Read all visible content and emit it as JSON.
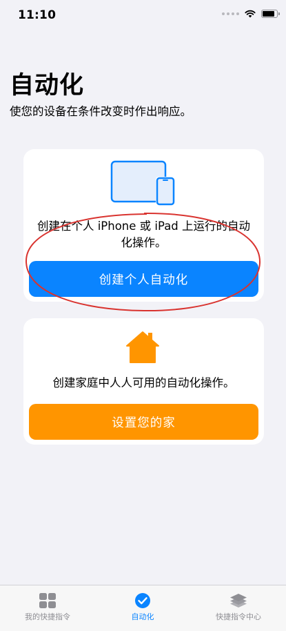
{
  "status_bar": {
    "time": "11:10"
  },
  "header": {
    "title": "自动化",
    "subtitle": "使您的设备在条件改变时作出响应。"
  },
  "personal_card": {
    "icon": "iphone-ipad-icon",
    "description_line1": "创建在个人 iPhone 或 iPad 上运行的自动",
    "description_line2": "化操作。",
    "button_label": "创建个人自动化"
  },
  "home_card": {
    "icon": "house-icon",
    "description": "创建家庭中人人可用的自动化操作。",
    "button_label": "设置您的家"
  },
  "tab_bar": {
    "tabs": [
      {
        "label": "我的快捷指令",
        "icon": "grid-icon",
        "active": false
      },
      {
        "label": "自动化",
        "icon": "automation-check-icon",
        "active": true
      },
      {
        "label": "快捷指令中心",
        "icon": "stack-icon",
        "active": false
      }
    ]
  },
  "colors": {
    "accent_blue": "#0A84FF",
    "home_orange": "#FF9500",
    "annotation_red": "#D9332F",
    "background": "#F2F2F7"
  }
}
